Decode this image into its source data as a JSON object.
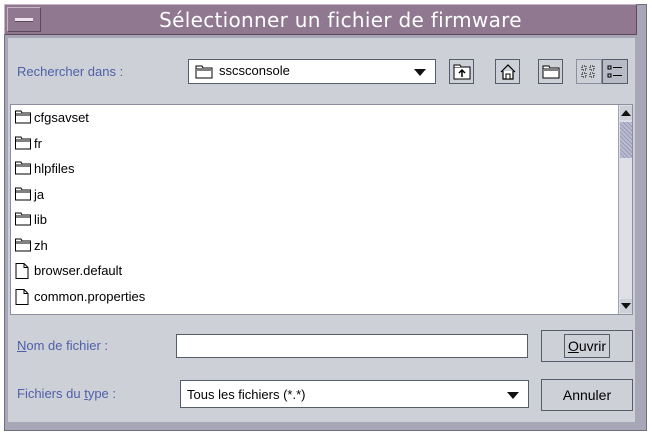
{
  "window": {
    "title": "Sélectionner un fichier de firmware"
  },
  "toolbar": {
    "look_in_label": "Rechercher dans :",
    "look_in_value": "sscsconsole",
    "up_icon": "folder-up-icon",
    "home_icon": "home-icon",
    "new_folder_icon": "new-folder-icon",
    "list_view_icon": "list-view-icon",
    "details_view_icon": "details-view-icon"
  },
  "files": [
    {
      "name": "cfgsavset",
      "type": "folder"
    },
    {
      "name": "fr",
      "type": "folder"
    },
    {
      "name": "hlpfiles",
      "type": "folder"
    },
    {
      "name": "ja",
      "type": "folder"
    },
    {
      "name": "lib",
      "type": "folder"
    },
    {
      "name": "zh",
      "type": "folder"
    },
    {
      "name": "browser.default",
      "type": "file"
    },
    {
      "name": "common.properties",
      "type": "file"
    }
  ],
  "filename": {
    "label_mnemonic": "N",
    "label_rest": "om de fichier :",
    "value": ""
  },
  "filetype": {
    "label_pre": "Fichiers du ",
    "label_mnemonic": "t",
    "label_post": "ype :",
    "value": "Tous les fichiers (*.*)"
  },
  "buttons": {
    "open_mnemonic": "O",
    "open_rest": "uvrir",
    "cancel": "Annuler"
  },
  "colors": {
    "titlebar": "#8f7890",
    "frame": "#a7a7b7",
    "panel": "#ced0d8",
    "label_text": "#4e60a8"
  }
}
